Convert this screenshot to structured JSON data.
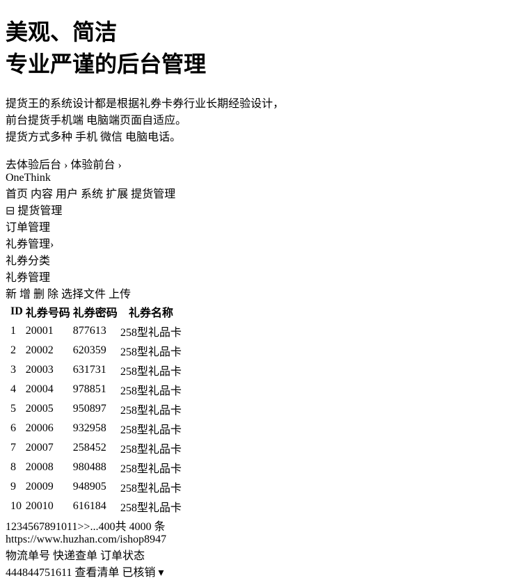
{
  "hero": {
    "title_line1": "美观、简洁",
    "title_line2": "专业严谨的后台管理",
    "desc_line1": "提货王的系统设计都是根据礼券卡券行业长期经验设计，",
    "desc_line2": "前台提货手机端 电脑端页面自适应。",
    "desc_line3": "提货方式多种 手机 微信 电脑电话。",
    "link_backend": "去体验后台",
    "link_frontend": "体验前台",
    "chevron": "›"
  },
  "watermark": "https://www.huzhan.com/ishop8947",
  "admin": {
    "logo": "OneThink",
    "nav": [
      "首页",
      "内容",
      "用户",
      "系统",
      "扩展",
      "提货管理"
    ],
    "sidebar_group": "提货管理",
    "sidebar_group_icon": "⊟",
    "sidebar_items": [
      "订单管理",
      "礼券管理",
      "礼券分类"
    ],
    "sidebar_arrow": "›",
    "main_title": "礼券管理",
    "buttons": [
      "新 增",
      "删 除",
      "选择文件",
      "上传"
    ],
    "table_headers": [
      "ID",
      "礼券号码",
      "礼券密码",
      "礼券名称"
    ],
    "rows": [
      {
        "id": "1",
        "code": "20001",
        "pwd": "877613",
        "name": "258型礼品卡"
      },
      {
        "id": "2",
        "code": "20002",
        "pwd": "620359",
        "name": "258型礼品卡"
      },
      {
        "id": "3",
        "code": "20003",
        "pwd": "631731",
        "name": "258型礼品卡"
      },
      {
        "id": "4",
        "code": "20004",
        "pwd": "978851",
        "name": "258型礼品卡"
      },
      {
        "id": "5",
        "code": "20005",
        "pwd": "950897",
        "name": "258型礼品卡"
      },
      {
        "id": "6",
        "code": "20006",
        "pwd": "932958",
        "name": "258型礼品卡"
      },
      {
        "id": "7",
        "code": "20007",
        "pwd": "258452",
        "name": "258型礼品卡"
      },
      {
        "id": "8",
        "code": "20008",
        "pwd": "980488",
        "name": "258型礼品卡"
      },
      {
        "id": "9",
        "code": "20009",
        "pwd": "948905",
        "name": "258型礼品卡"
      },
      {
        "id": "10",
        "code": "20010",
        "pwd": "616184",
        "name": "258型礼品卡"
      }
    ],
    "pager": [
      "1",
      "2",
      "3",
      "4",
      "5",
      "6",
      "7",
      "8",
      "9",
      "10",
      "11",
      ">>",
      "...400"
    ],
    "pager_total": "共 4000 条"
  },
  "mini_table": {
    "headers": [
      "物流单号",
      "快递查单",
      "订单状态"
    ],
    "row": {
      "tracking": "444844751611",
      "check_btn": "查看清单",
      "status_btn": "已核销 ▾"
    }
  },
  "colors": {
    "accent_green": "#6dbb2a",
    "link_blue": "#3f8fd6",
    "admin_dark": "#2b2b2b",
    "highlight_red": "#e00000"
  }
}
